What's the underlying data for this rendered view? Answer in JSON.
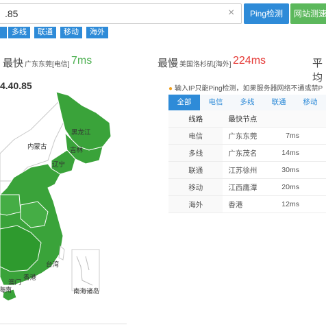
{
  "topbar": {
    "input_value": ".85",
    "clear_icon": "×",
    "ping_button": "Ping检测",
    "speed_button": "网站测速"
  },
  "filters": [
    "电信",
    "多线",
    "联通",
    "移动",
    "海外"
  ],
  "stats": {
    "fastest": {
      "title": "最快",
      "node": "广东东莞[电信]",
      "value": "7ms",
      "color": "#4caf50"
    },
    "slowest": {
      "title": "最慢",
      "node": "美国洛杉矶[海外]",
      "value": "224ms",
      "color": "#e53935"
    },
    "average": {
      "title": "平均"
    }
  },
  "map": {
    "ip_label": "4.40.85",
    "fill_color": "#3aa33a",
    "labels": [
      "黑龙江",
      "吉林",
      "辽宁",
      "内蒙古",
      "台湾",
      "香港",
      "澳门",
      "海南",
      "南海诸岛"
    ]
  },
  "hint": {
    "icon": "speaker-icon",
    "text": "输入IP只能Ping检测，如果服务器网络不通或禁P"
  },
  "tabs": [
    "全部",
    "电信",
    "多线",
    "联通",
    "移动"
  ],
  "table": {
    "headers": [
      "线路",
      "最快节点",
      "",
      ""
    ],
    "rows": [
      {
        "line": "电信",
        "node": "广东东莞",
        "time": "7ms"
      },
      {
        "line": "多线",
        "node": "广东茂名",
        "time": "14ms"
      },
      {
        "line": "联通",
        "node": "江苏徐州",
        "time": "30ms"
      },
      {
        "line": "移动",
        "node": "江西鹰潭",
        "time": "20ms"
      },
      {
        "line": "海外",
        "node": "香港",
        "time": "12ms"
      }
    ]
  }
}
